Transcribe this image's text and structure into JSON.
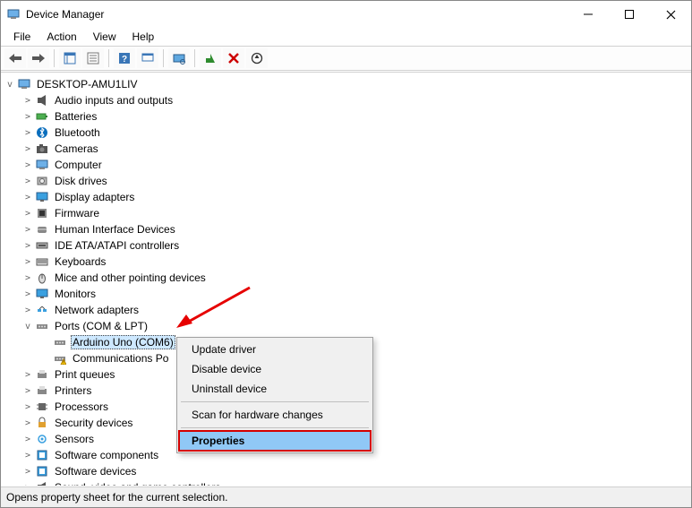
{
  "window": {
    "title": "Device Manager"
  },
  "menubar": {
    "file": "File",
    "action": "Action",
    "view": "View",
    "help": "Help"
  },
  "toolbar": {
    "back": "Back",
    "forward": "Forward",
    "show_hide": "Show/Hide Console Tree",
    "properties": "Properties",
    "help": "Help",
    "action_center": "Action Center",
    "scan": "Scan for hardware changes",
    "enable": "Enable device",
    "uninstall": "Uninstall device",
    "update": "Update driver"
  },
  "tree": {
    "root": "DESKTOP-AMU1LIV",
    "items": [
      {
        "label": "Audio inputs and outputs",
        "icon": "speaker"
      },
      {
        "label": "Batteries",
        "icon": "battery"
      },
      {
        "label": "Bluetooth",
        "icon": "bluetooth"
      },
      {
        "label": "Cameras",
        "icon": "camera"
      },
      {
        "label": "Computer",
        "icon": "computer"
      },
      {
        "label": "Disk drives",
        "icon": "disk"
      },
      {
        "label": "Display adapters",
        "icon": "display"
      },
      {
        "label": "Firmware",
        "icon": "firmware"
      },
      {
        "label": "Human Interface Devices",
        "icon": "hid"
      },
      {
        "label": "IDE ATA/ATAPI controllers",
        "icon": "ide"
      },
      {
        "label": "Keyboards",
        "icon": "keyboard"
      },
      {
        "label": "Mice and other pointing devices",
        "icon": "mouse"
      },
      {
        "label": "Monitors",
        "icon": "monitor"
      },
      {
        "label": "Network adapters",
        "icon": "network"
      }
    ],
    "ports": {
      "label": "Ports (COM & LPT)",
      "children": [
        {
          "label": "Arduino Uno (COM6)",
          "selected": true,
          "icon": "port"
        },
        {
          "label": "Communications Po",
          "warn": true,
          "icon": "port"
        }
      ]
    },
    "after_ports": [
      {
        "label": "Print queues",
        "icon": "printqueue"
      },
      {
        "label": "Printers",
        "icon": "printer"
      },
      {
        "label": "Processors",
        "icon": "cpu"
      },
      {
        "label": "Security devices",
        "icon": "security"
      },
      {
        "label": "Sensors",
        "icon": "sensor"
      },
      {
        "label": "Software components",
        "icon": "software"
      },
      {
        "label": "Software devices",
        "icon": "software"
      },
      {
        "label": "Sound, video and game controllers",
        "icon": "sound"
      }
    ]
  },
  "context_menu": {
    "update": "Update driver",
    "disable": "Disable device",
    "uninstall": "Uninstall device",
    "scan": "Scan for hardware changes",
    "properties": "Properties"
  },
  "statusbar": {
    "text": "Opens property sheet for the current selection."
  }
}
